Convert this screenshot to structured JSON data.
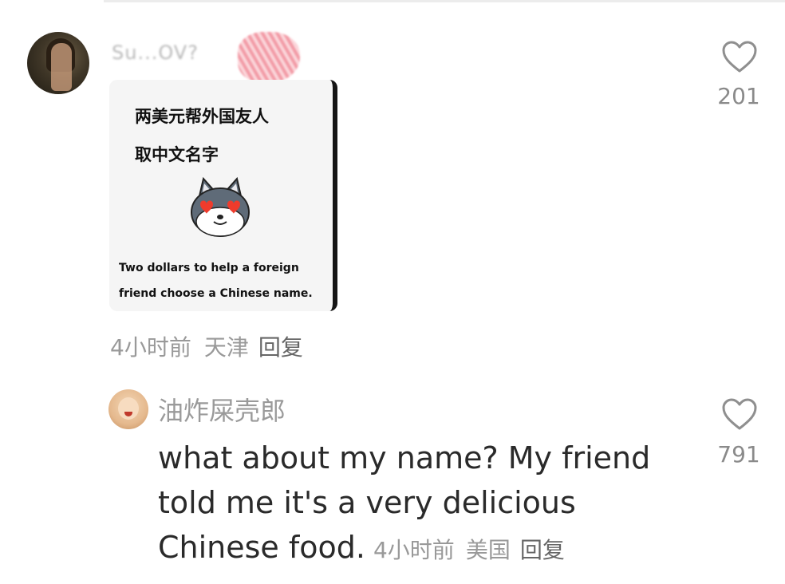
{
  "comment1": {
    "username": "Su...OV?",
    "card": {
      "line1": "两美元帮外国友人",
      "line2": "取中文名字",
      "en_line1": "Two dollars to help a foreign",
      "en_line2": "friend choose a Chinese name."
    },
    "time": "4小时前",
    "location": "天津",
    "reply_label": "回复",
    "likes": "201"
  },
  "comment2": {
    "username": "油炸屎壳郎",
    "text": "what about my name? My friend told me it's a very delicious Chinese food.",
    "time": "4小时前",
    "location": "美国",
    "reply_label": "回复",
    "likes": "791"
  },
  "icons": {
    "like": "heart-outline-icon",
    "sticker": "dog-heart-eyes-icon"
  },
  "colors": {
    "meta": "#999999",
    "username": "#9a9a9a",
    "redaction": "#f08a97"
  }
}
